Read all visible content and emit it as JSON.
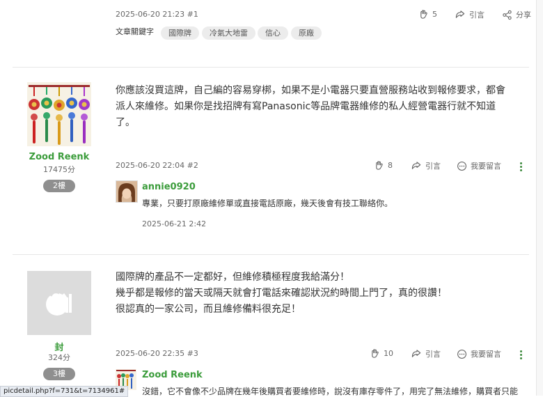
{
  "post1": {
    "meta": "2025-06-20 21:23 #1",
    "tags_label": "文章關鍵字",
    "tags": [
      "國際牌",
      "冷氣大地雷",
      "信心",
      "原廠"
    ],
    "like_count": "5",
    "quote_label": "引言",
    "share_label": "分享"
  },
  "post2": {
    "author": "Zood Reenk",
    "score": "17475分",
    "floor": "2樓",
    "content": [
      "你應該沒買這牌，自己編的容易穿梆，如果不是小電器只要直營服務站收到報修要求，都會",
      "派人來維修。如果你是找招牌有寫Panasonic等品牌電器維修的私人經營電器行就不知道",
      "了。"
    ],
    "meta": "2025-06-20 22:04 #2",
    "like_count": "8",
    "quote_label": "引言",
    "comment_label": "我要留言",
    "reply": {
      "name": "annie0920",
      "text": "專業，只要打原廠維修單或直接電話原廠，幾天後會有技工聯絡你。",
      "time": "2025-06-21 2:42"
    }
  },
  "post3": {
    "author": "封",
    "score": "324分",
    "floor": "3樓",
    "content": [
      "國際牌的產品不一定都好，但維修積極程度我給滿分！",
      "幾乎都是報修的當天或隔天就會打電話來確認狀況約時間上門了，真的很讚！",
      "很認真的一家公司，而且維修備料很充足！"
    ],
    "meta": "2025-06-20 22:35 #3",
    "like_count": "10",
    "quote_label": "引言",
    "comment_label": "我要留言",
    "reply": {
      "name": "Zood Reenk",
      "text": "沒錯，它不會像不少品牌在幾年後購買者要維修時，說沒有庫存零件了，用完了無法維修，購買者只能"
    }
  },
  "statusbar": "picdetail.php?f=731&t=7134961#",
  "colors": {
    "accent_green": "#3b9c3b",
    "tag_bg": "#ececec",
    "floor_bg": "#8f8f8f"
  }
}
